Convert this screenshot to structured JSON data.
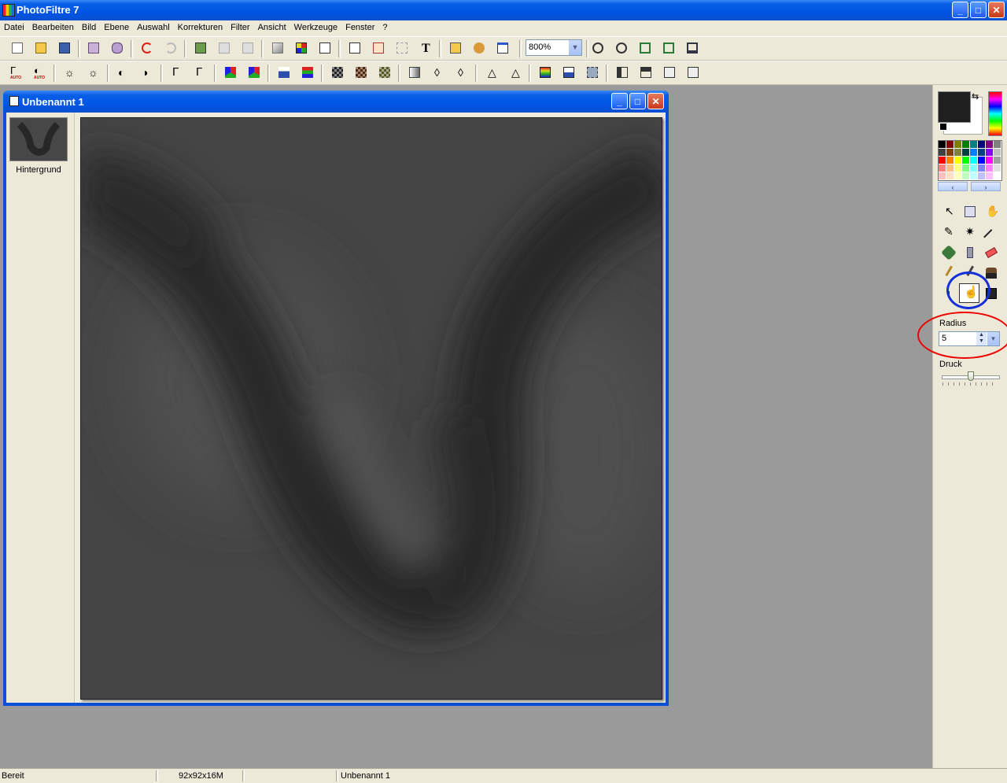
{
  "app": {
    "title": "PhotoFiltre 7",
    "window_buttons": {
      "minimize": "_",
      "maximize": "□",
      "close": "✕"
    }
  },
  "menu": [
    "Datei",
    "Bearbeiten",
    "Bild",
    "Ebene",
    "Auswahl",
    "Korrekturen",
    "Filter",
    "Ansicht",
    "Werkzeuge",
    "Fenster",
    "?"
  ],
  "toolbar": {
    "zoom_value": "800%",
    "text_tool_glyph": "T",
    "auto_label": "AUTO"
  },
  "document": {
    "title": "Unbenannt 1",
    "layer_name": "Hintergrund"
  },
  "palette": {
    "nav_left": "‹",
    "nav_right": "›",
    "swatches": [
      "#000000",
      "#800000",
      "#808000",
      "#008000",
      "#008080",
      "#000080",
      "#800080",
      "#808080",
      "#404040",
      "#804000",
      "#808040",
      "#004040",
      "#0080ff",
      "#004080",
      "#8000ff",
      "#c0c0c0",
      "#ff0000",
      "#ff8000",
      "#ffff00",
      "#00ff00",
      "#00ffff",
      "#0000ff",
      "#ff00ff",
      "#a0a0a0",
      "#ff8080",
      "#ffc080",
      "#ffff80",
      "#80ff80",
      "#80ffff",
      "#8080ff",
      "#ff80ff",
      "#e0e0e0",
      "#ffc0c0",
      "#ffe0c0",
      "#ffffc0",
      "#c0ffc0",
      "#c0ffff",
      "#c0c0ff",
      "#ffc0ff",
      "#ffffff"
    ]
  },
  "colors": {
    "foreground": "#1f1f1f",
    "background": "#ffffff",
    "titlebar_blue": "#0055e5"
  },
  "tool_options": {
    "radius_label": "Radius",
    "radius_value": "5",
    "pressure_label": "Druck",
    "pressure_level": 0.5
  },
  "status": {
    "state": "Bereit",
    "image_info": "92x92x16M",
    "doc_name": "Unbenannt 1"
  }
}
